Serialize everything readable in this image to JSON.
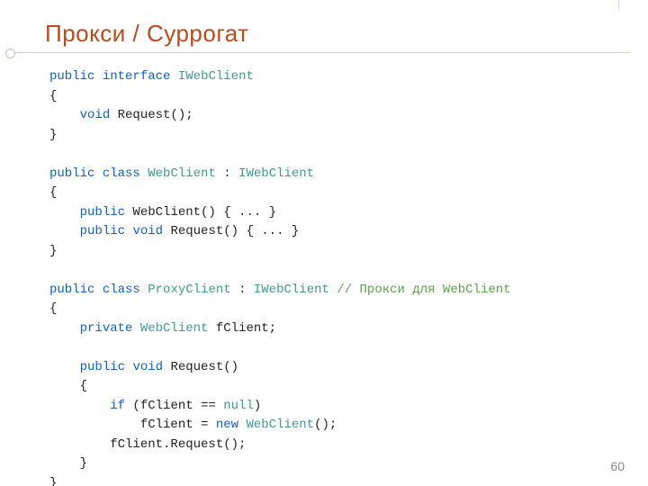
{
  "slide": {
    "title": "Прокси / Суррогат",
    "page_number": "60"
  },
  "code": {
    "lines": [
      [
        {
          "t": "public",
          "c": "kw"
        },
        {
          "t": " "
        },
        {
          "t": "interface",
          "c": "kw"
        },
        {
          "t": " "
        },
        {
          "t": "IWebClient",
          "c": "type"
        }
      ],
      [
        {
          "t": "{"
        }
      ],
      [
        {
          "t": "    "
        },
        {
          "t": "void",
          "c": "kw"
        },
        {
          "t": " Request();"
        }
      ],
      [
        {
          "t": "}"
        }
      ],
      [],
      [
        {
          "t": "public",
          "c": "kw"
        },
        {
          "t": " "
        },
        {
          "t": "class",
          "c": "kw"
        },
        {
          "t": " "
        },
        {
          "t": "WebClient",
          "c": "type"
        },
        {
          "t": " : "
        },
        {
          "t": "IWebClient",
          "c": "type"
        }
      ],
      [
        {
          "t": "{"
        }
      ],
      [
        {
          "t": "    "
        },
        {
          "t": "public",
          "c": "kw"
        },
        {
          "t": " WebClient() { ... }"
        }
      ],
      [
        {
          "t": "    "
        },
        {
          "t": "public",
          "c": "kw"
        },
        {
          "t": " "
        },
        {
          "t": "void",
          "c": "kw"
        },
        {
          "t": " Request() { ... }"
        }
      ],
      [
        {
          "t": "}"
        }
      ],
      [],
      [
        {
          "t": "public",
          "c": "kw"
        },
        {
          "t": " "
        },
        {
          "t": "class",
          "c": "kw"
        },
        {
          "t": " "
        },
        {
          "t": "ProxyClient",
          "c": "type"
        },
        {
          "t": " : "
        },
        {
          "t": "IWebClient",
          "c": "type"
        },
        {
          "t": " "
        },
        {
          "t": "// Прокси для WebClient",
          "c": "cmt"
        }
      ],
      [
        {
          "t": "{"
        }
      ],
      [
        {
          "t": "    "
        },
        {
          "t": "private",
          "c": "kw"
        },
        {
          "t": " "
        },
        {
          "t": "WebClient",
          "c": "type"
        },
        {
          "t": " fClient;"
        }
      ],
      [],
      [
        {
          "t": "    "
        },
        {
          "t": "public",
          "c": "kw"
        },
        {
          "t": " "
        },
        {
          "t": "void",
          "c": "kw"
        },
        {
          "t": " Request()"
        }
      ],
      [
        {
          "t": "    {"
        }
      ],
      [
        {
          "t": "        "
        },
        {
          "t": "if",
          "c": "kw"
        },
        {
          "t": " (fClient == "
        },
        {
          "t": "null",
          "c": "type"
        },
        {
          "t": ")"
        }
      ],
      [
        {
          "t": "            fClient = "
        },
        {
          "t": "new",
          "c": "kw"
        },
        {
          "t": " "
        },
        {
          "t": "WebClient",
          "c": "type"
        },
        {
          "t": "();"
        }
      ],
      [
        {
          "t": "        fClient.Request();"
        }
      ],
      [
        {
          "t": "    }"
        }
      ],
      [
        {
          "t": "}"
        }
      ]
    ]
  }
}
